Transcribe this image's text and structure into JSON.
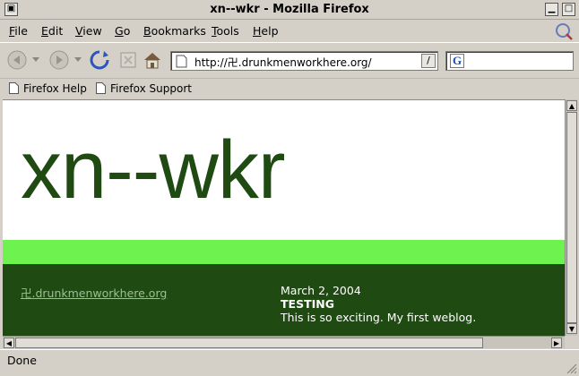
{
  "window": {
    "title": "xn--wkr - Mozilla Firefox"
  },
  "menubar": {
    "items": [
      {
        "label": "File",
        "accel": "F",
        "rest": "ile"
      },
      {
        "label": "Edit",
        "accel": "E",
        "rest": "dit"
      },
      {
        "label": "View",
        "accel": "V",
        "rest": "iew"
      },
      {
        "label": "Go",
        "accel": "G",
        "rest": "o"
      },
      {
        "label": "Bookmarks",
        "accel": "B",
        "rest": "ookmarks"
      },
      {
        "label": "Tools",
        "accel": "T",
        "rest": "ools"
      },
      {
        "label": "Help",
        "accel": "H",
        "rest": "elp"
      }
    ]
  },
  "navbar": {
    "back": "back-arrow-icon",
    "forward": "forward-arrow-icon",
    "reload": "reload-icon",
    "stop": "stop-icon",
    "home": "home-icon",
    "url": "http://卍.drunkmenworkhere.org/",
    "search_engine": "G"
  },
  "bookmarks": {
    "items": [
      {
        "label": "Firefox Help"
      },
      {
        "label": "Firefox Support"
      }
    ]
  },
  "page": {
    "heading": "xn--wkr",
    "site_link": "卍.drunkmenworkhere.org",
    "post": {
      "date": "March 2, 2004",
      "title": "TESTING",
      "body": "This is so exciting. My first weblog."
    },
    "colors": {
      "dark_green": "#1f4a12",
      "light_green": "#6ef24f",
      "link": "#9fbf93"
    }
  },
  "status": {
    "text": "Done"
  }
}
